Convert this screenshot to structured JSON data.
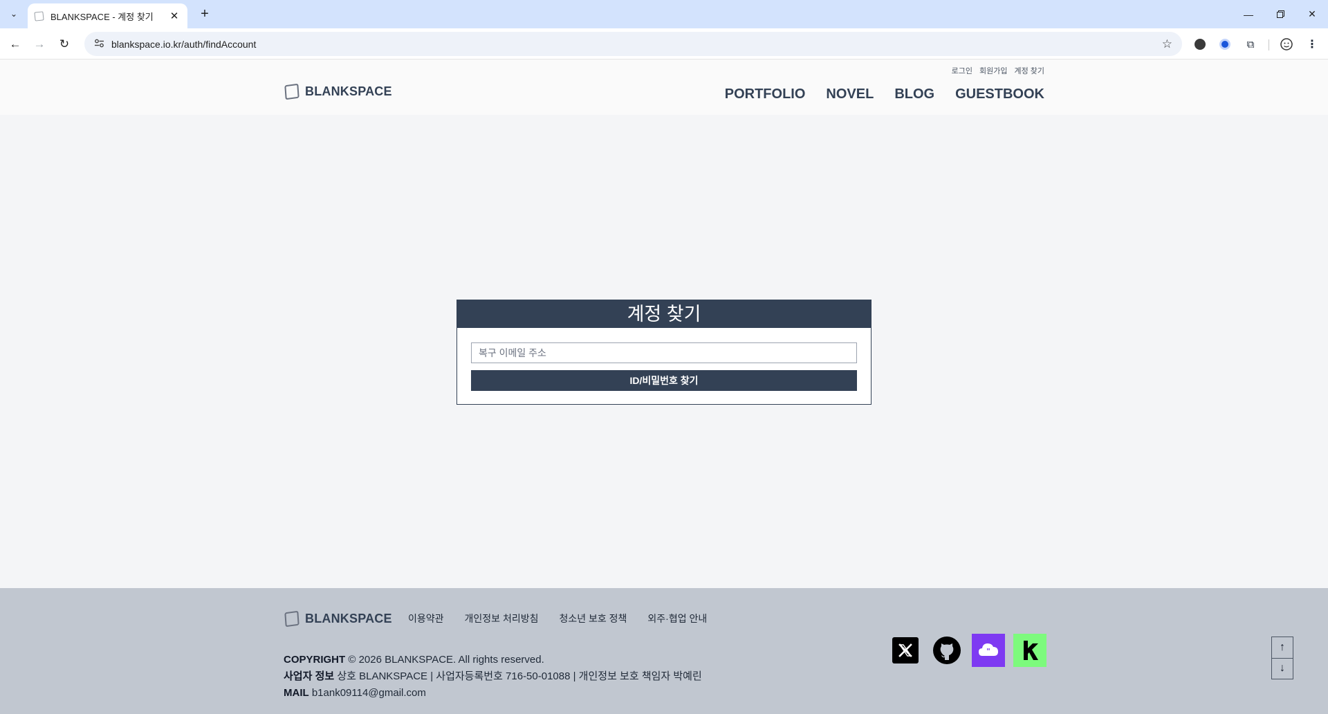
{
  "browser": {
    "tab_title": "BLANKSPACE - 계정 찾기",
    "url": "blankspace.io.kr/auth/findAccount"
  },
  "header": {
    "logo_text": "BLANKSPACE",
    "util_links": [
      "로그인",
      "회원가입",
      "계정 찾기"
    ],
    "nav": [
      "PORTFOLIO",
      "NOVEL",
      "BLOG",
      "GUESTBOOK"
    ]
  },
  "form": {
    "title": "계정 찾기",
    "email_placeholder": "복구 이메일 주소",
    "submit_label": "ID/비밀번호 찾기"
  },
  "footer": {
    "logo_text": "BLANKSPACE",
    "links": [
      "이용약관",
      "개인정보 처리방침",
      "청소년 보호 정책",
      "외주·협업 안내"
    ],
    "copyright_label": "COPYRIGHT",
    "copyright_text": "© 2026 BLANKSPACE. All rights reserved.",
    "business_label": "사업자 정보",
    "business_text": "상호 BLANKSPACE | 사업자등록번호 716-50-01088 | 개인정보 보호 책임자 박예린",
    "mail_label": "MAIL",
    "mail_text": "b1ank09114@gmail.com",
    "socials": [
      "x-icon",
      "github-icon",
      "quote-bubble-icon",
      "kakao-k-icon"
    ]
  },
  "colors": {
    "primary": "#334155",
    "footer_bg": "#c1c7d0",
    "page_bg": "#f4f5f7",
    "quote_purple": "#7e3af2",
    "k_green": "#7dfa7d"
  }
}
